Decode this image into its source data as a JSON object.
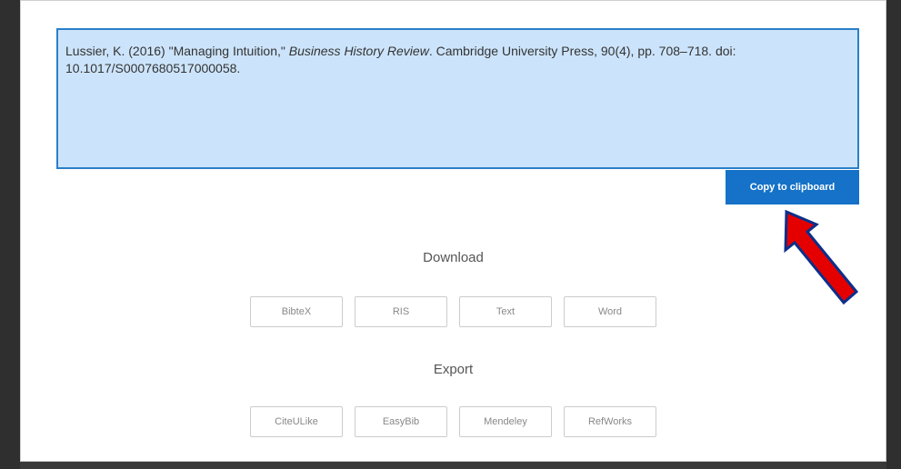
{
  "citation": {
    "part1": "Lussier, K. (2016) \"Managing Intuition,\" ",
    "journal": "Business History Review",
    "part2": ". Cambridge University Press, 90(4), pp. 708–718. doi: 10.1017/S0007680517000058."
  },
  "copy_button_label": "Copy to clipboard",
  "download": {
    "title": "Download",
    "buttons": [
      "BibteX",
      "RIS",
      "Text",
      "Word"
    ]
  },
  "export": {
    "title": "Export",
    "buttons": [
      "CiteULike",
      "EasyBib",
      "Mendeley",
      "RefWorks"
    ]
  },
  "colors": {
    "accent": "#1572c8",
    "citation_bg": "#cce4fb",
    "annotation_arrow": "#e50000"
  }
}
